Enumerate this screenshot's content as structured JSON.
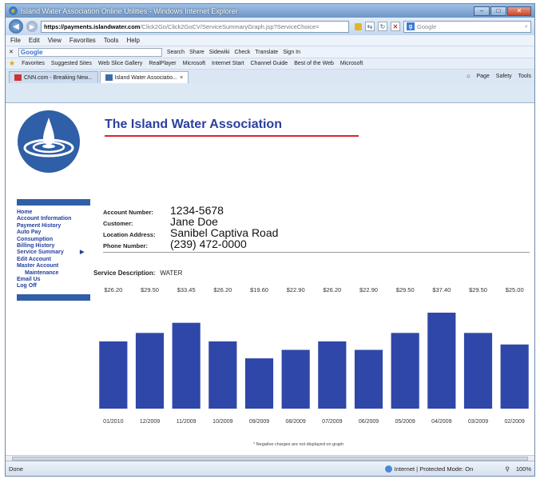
{
  "window": {
    "title": "Island Water Association Online Utilities - Windows Internet Explorer",
    "buttons": {
      "minimize": "–",
      "maximize": "□",
      "close": "✕"
    }
  },
  "address": {
    "url_proto": "https://",
    "url_domain": "payments.islandwater.com",
    "url_path": "/Click2Go/Click2GoCV/ServiceSummaryGraph.jsp?ServiceChoice=",
    "search_placeholder": "Google"
  },
  "menu": [
    "File",
    "Edit",
    "View",
    "Favorites",
    "Tools",
    "Help"
  ],
  "googlebar": {
    "logo": "Google",
    "items": [
      "Search",
      "Share",
      "Sidewiki",
      "Check",
      "Translate",
      "Sign In"
    ]
  },
  "favorites": {
    "label": "Favorites",
    "items": [
      "Suggested Sites",
      "Web Slice Gallery",
      "RealPlayer",
      "Microsoft",
      "Internet Start",
      "Channel Guide",
      "Best of the Web",
      "Microsoft"
    ]
  },
  "tabs": [
    {
      "label": "CNN.com - Breaking New..."
    },
    {
      "label": "Island Water Associatio..."
    }
  ],
  "tab_tools": [
    "Page",
    "Safety",
    "Tools"
  ],
  "page": {
    "org_name": "The Island Water Association",
    "sidebar": [
      {
        "label": "Home"
      },
      {
        "label": "Account Information"
      },
      {
        "label": "Payment History"
      },
      {
        "label": "Auto Pay"
      },
      {
        "label": "Consumption"
      },
      {
        "label": "Billing History"
      },
      {
        "label": "Service Summary"
      },
      {
        "label": "Edit Account"
      },
      {
        "label": "Master Account"
      },
      {
        "label": "Maintenance"
      },
      {
        "label": "Email Us"
      },
      {
        "label": "Log Off"
      }
    ],
    "account": {
      "number_label": "Account Number:",
      "number": "1234-5678",
      "customer_label": "Customer:",
      "customer": "Jane Doe",
      "location_label": "Location Address:",
      "location": "Sanibel Captiva Road",
      "phone_label": "Phone Number:",
      "phone": "(239) 472-0000"
    },
    "service_label": "Service Description:",
    "service_value": "WATER",
    "note": "* Negative charges are not displayed on graph"
  },
  "chart_data": {
    "type": "bar",
    "categories": [
      "01/2010",
      "12/2009",
      "11/2009",
      "10/2009",
      "09/2009",
      "08/2009",
      "07/2009",
      "06/2009",
      "05/2009",
      "04/2009",
      "03/2009",
      "02/2009"
    ],
    "values": [
      26.2,
      29.5,
      33.45,
      26.2,
      19.6,
      22.9,
      26.2,
      22.9,
      29.5,
      37.4,
      29.5,
      25.0
    ],
    "value_labels": [
      "$26.20",
      "$29.50",
      "$33.45",
      "$26.20",
      "$19.60",
      "$22.90",
      "$26.20",
      "$22.90",
      "$29.50",
      "$37.40",
      "$29.50",
      "$25.00"
    ],
    "bar_color": "#2f47a8",
    "title": "",
    "xlabel": "",
    "ylabel": ""
  },
  "status": {
    "left": "Done",
    "zone": "Internet | Protected Mode: On",
    "zoom": "100%"
  }
}
